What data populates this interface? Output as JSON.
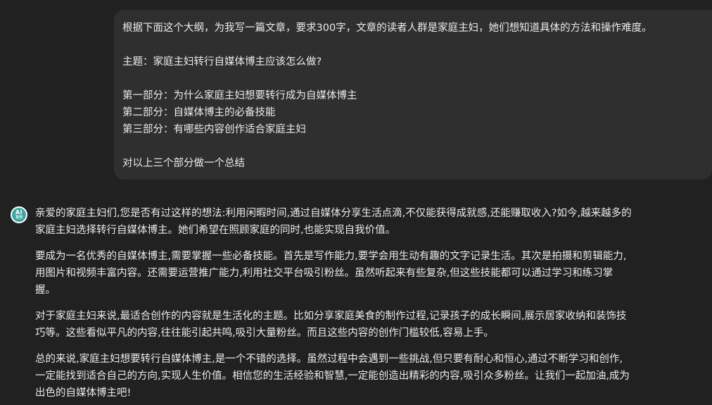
{
  "user_message": {
    "lines": [
      "根据下面这个大纲，为我写一篇文章，要求300字，文章的读者人群是家庭主妇，她们想知道具体的方法和操作难度。",
      "",
      "主题：家庭主妇转行自媒体博主应该怎么做?",
      "",
      "第一部分：为什么家庭主妇想要转行成为自媒体博主",
      "第二部分：自媒体博主的必备技能",
      "第三部分：有哪些内容创作适合家庭主妇",
      "",
      "对以上三个部分做一个总结"
    ]
  },
  "assistant": {
    "avatar_label": "AI",
    "avatar_sublabel": "写作",
    "paragraphs": [
      [
        "亲爱的家庭主妇们,您是否有过这样的想法:利用闲暇时间,通过自媒体分享生活点滴,不仅能获得成就感,还能赚取收入?如今,越来越多的",
        "家庭主妇选择转行自媒体博主。她们希望在照顾家庭的同时,也能实现自我价值。"
      ],
      [
        "要成为一名优秀的自媒体博主,需要掌握一些必备技能。首先是写作能力,要学会用生动有趣的文字记录生活。其次是拍摄和剪辑能力,",
        "用图片和视频丰富内容。还需要运营推广能力,利用社交平台吸引粉丝。虽然听起来有些复杂,但这些技能都可以通过学习和练习掌",
        "握。"
      ],
      [
        "对于家庭主妇来说,最适合创作的内容就是生活化的主题。比如分享家庭美食的制作过程,记录孩子的成长瞬间,展示居家收纳和装饰技",
        "巧等。这些看似平凡的内容,往往能引起共鸣,吸引大量粉丝。而且这些内容的创作门槛较低,容易上手。"
      ],
      [
        "总的来说,家庭主妇想要转行自媒体博主,是一个不错的选择。虽然过程中会遇到一些挑战,但只要有耐心和恒心,通过不断学习和创作,",
        "一定能找到适合自己的方向,实现人生价值。相信您的生活经验和智慧,一定能创造出精彩的内容,吸引众多粉丝。让我们一起加油,成为",
        "出色的自媒体博主吧!"
      ]
    ]
  },
  "colors": {
    "background": "#212121",
    "user_bubble": "#2f2f2f",
    "text": "#ececec",
    "avatar_accent": "#3ea6a0"
  },
  "icons": {
    "assistant_avatar": "ai-writing-avatar-icon"
  }
}
